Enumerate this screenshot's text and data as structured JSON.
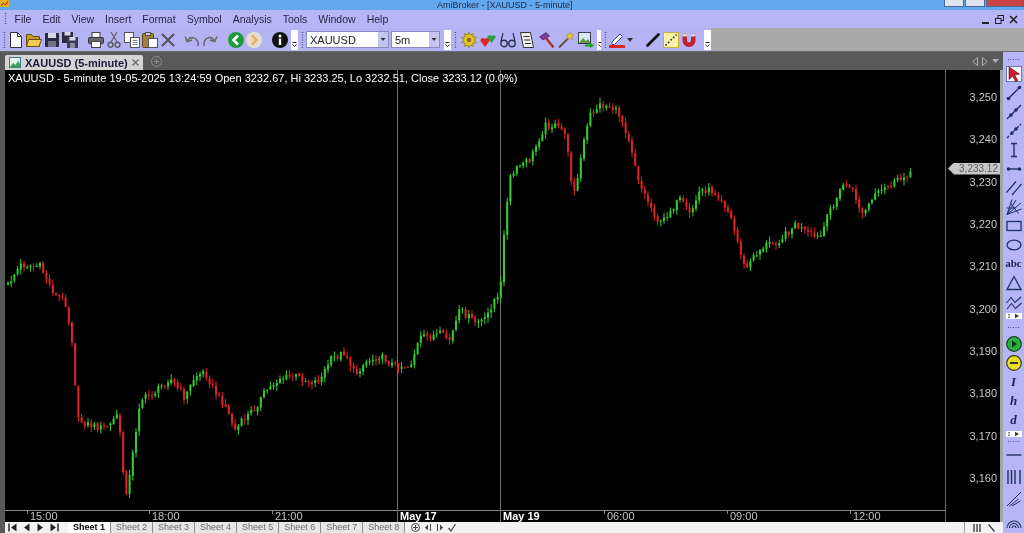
{
  "window": {
    "title": "AmiBroker - [XAUUSD - 5-minute]"
  },
  "menu": [
    "File",
    "Edit",
    "View",
    "Insert",
    "Format",
    "Symbol",
    "Analysis",
    "Tools",
    "Window",
    "Help"
  ],
  "toolbar": {
    "history_buttons": [
      {
        "disabled": false
      },
      {
        "disabled": true
      }
    ],
    "symbol": "XAUUSD",
    "interval": "5m",
    "style_buttons": [
      {
        "pressed": false
      },
      {
        "pressed": true
      },
      {
        "pressed": false
      }
    ]
  },
  "chart_tab": {
    "title": "XAUUSD (5-minute)",
    "selected": true
  },
  "chart": {
    "info": "XAUUSD - 5-minute 19-05-2025 13:24:59 Open 3232.67, Hi 3233.25, Lo 3232.51, Close 3233.12 (0.0%)",
    "price_labels": [
      "3,250",
      "3,240",
      "3,230",
      "3,220",
      "3,210",
      "3,200",
      "3,190",
      "3,180",
      "3,170",
      "3,160"
    ],
    "last_price": "3,233.12",
    "time_labels": [
      {
        "text": "15:00",
        "kind": "time"
      },
      {
        "text": "18:00",
        "kind": "time"
      },
      {
        "text": "21:00",
        "kind": "time"
      },
      {
        "text": "May 17",
        "kind": "date"
      },
      {
        "text": "May 19",
        "kind": "date"
      },
      {
        "text": "06:00",
        "kind": "time"
      },
      {
        "text": "09:00",
        "kind": "time"
      },
      {
        "text": "12:00",
        "kind": "time"
      }
    ]
  },
  "sheets": [
    {
      "label": "Sheet 1",
      "selected": true
    },
    {
      "label": "Sheet 2",
      "selected": false
    },
    {
      "label": "Sheet 3",
      "selected": false
    },
    {
      "label": "Sheet 4",
      "selected": false
    },
    {
      "label": "Sheet 5",
      "selected": false
    },
    {
      "label": "Sheet 6",
      "selected": false
    },
    {
      "label": "Sheet 7",
      "selected": false
    },
    {
      "label": "Sheet 8",
      "selected": false
    }
  ],
  "drawing_toolbar": {
    "groups": [
      {
        "tools": [
          {
            "kind": "icon",
            "selected": true
          },
          {
            "kind": "icon",
            "selected": false
          },
          {
            "kind": "icon",
            "selected": false
          },
          {
            "kind": "icon",
            "selected": false
          },
          {
            "kind": "icon",
            "selected": false
          },
          {
            "kind": "icon",
            "selected": false
          },
          {
            "kind": "icon",
            "selected": false
          },
          {
            "kind": "icon",
            "selected": false
          },
          {
            "kind": "icon",
            "selected": false
          },
          {
            "kind": "icon",
            "selected": false
          },
          {
            "kind": "text",
            "label": "abc",
            "selected": false
          },
          {
            "kind": "icon",
            "selected": false
          },
          {
            "kind": "icon",
            "selected": false
          }
        ]
      },
      {
        "tools": [
          {
            "kind": "icon",
            "selected": false
          },
          {
            "kind": "icon",
            "selected": false
          },
          {
            "kind": "text",
            "label": "I",
            "selected": false
          },
          {
            "kind": "text",
            "label": "h",
            "selected": false
          },
          {
            "kind": "text",
            "label": "d",
            "selected": false
          }
        ]
      },
      {
        "tools": [
          {
            "kind": "icon",
            "selected": false
          },
          {
            "kind": "icon",
            "selected": false
          },
          {
            "kind": "icon",
            "selected": false
          },
          {
            "kind": "icon",
            "selected": false
          }
        ]
      }
    ]
  }
}
